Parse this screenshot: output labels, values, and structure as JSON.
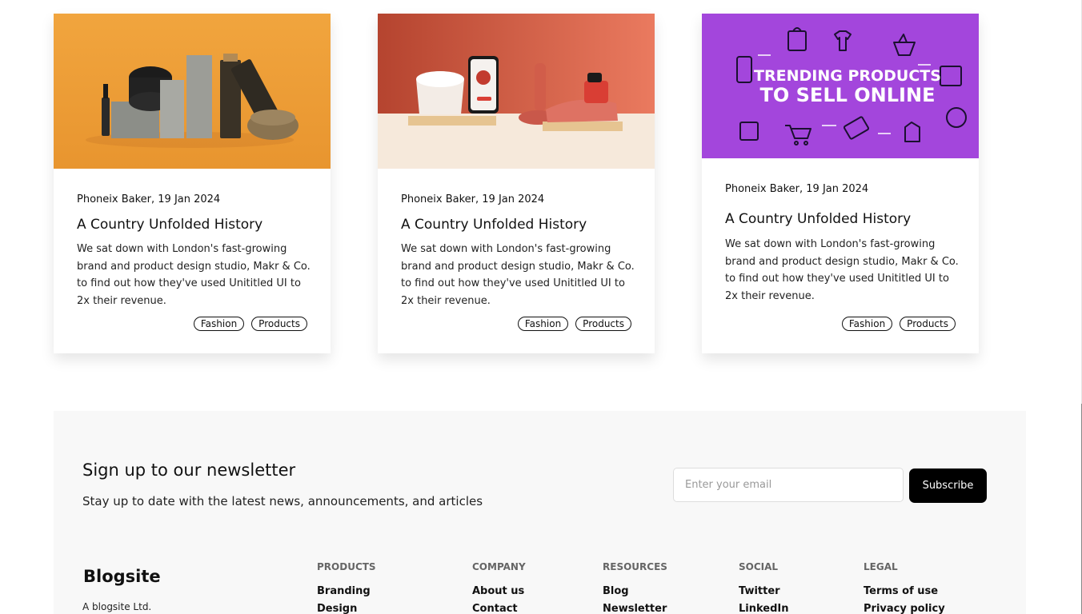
{
  "posts": [
    {
      "author_date": "Phoneix Baker, 19 Jan 2024",
      "title": "A Country Unfolded History",
      "excerpt": "We sat down with London's fast-growing brand and product design studio, Makr & Co. to find out how they've used Unititled UI to 2x their revenue.",
      "tags": [
        "Fashion",
        "Products"
      ]
    },
    {
      "author_date": "Phoneix Baker, 19 Jan 2024",
      "title": "A Country Unfolded History",
      "excerpt": "We sat down with London's fast-growing brand and product design studio, Makr & Co. to find out how they've used Unititled UI to 2x their revenue.",
      "tags": [
        "Fashion",
        "Products"
      ]
    },
    {
      "author_date": "Phoneix Baker, 19 Jan 2024",
      "title": "A Country Unfolded History",
      "excerpt": "We sat down with London's fast-growing brand and product design studio, Makr & Co. to find out how they've used Unititled UI to 2x their revenue.",
      "tags": [
        "Fashion",
        "Products"
      ],
      "image_text": [
        "TRENDING PRODUCTS",
        "TO SELL ONLINE"
      ]
    }
  ],
  "newsletter": {
    "title": "Sign up to our newsletter",
    "subtitle": "Stay up to date with the latest news, announcements, and articles",
    "email_placeholder": "Enter your email",
    "button": "Subscribe"
  },
  "footer": {
    "brand": "Blogsite",
    "brand_sub": "A blogsite Ltd.",
    "columns": [
      {
        "heading": "PRODUCTS",
        "links": [
          "Branding",
          "Design"
        ]
      },
      {
        "heading": "COMPANY",
        "links": [
          "About us",
          "Contact"
        ]
      },
      {
        "heading": "RESOURCES",
        "links": [
          "Blog",
          "Newsletter"
        ]
      },
      {
        "heading": "SOCIAL",
        "links": [
          "Twitter",
          "LinkedIn"
        ]
      },
      {
        "heading": "LEGAL",
        "links": [
          "Terms of use",
          "Privacy policy"
        ]
      }
    ]
  },
  "colors": {
    "accent_button": "#000000",
    "footer_bg": "#f8f8f8",
    "image1_bg": "#ee9f3c",
    "image2_bg": "#e07155",
    "image3_bg": "#a346dc"
  }
}
